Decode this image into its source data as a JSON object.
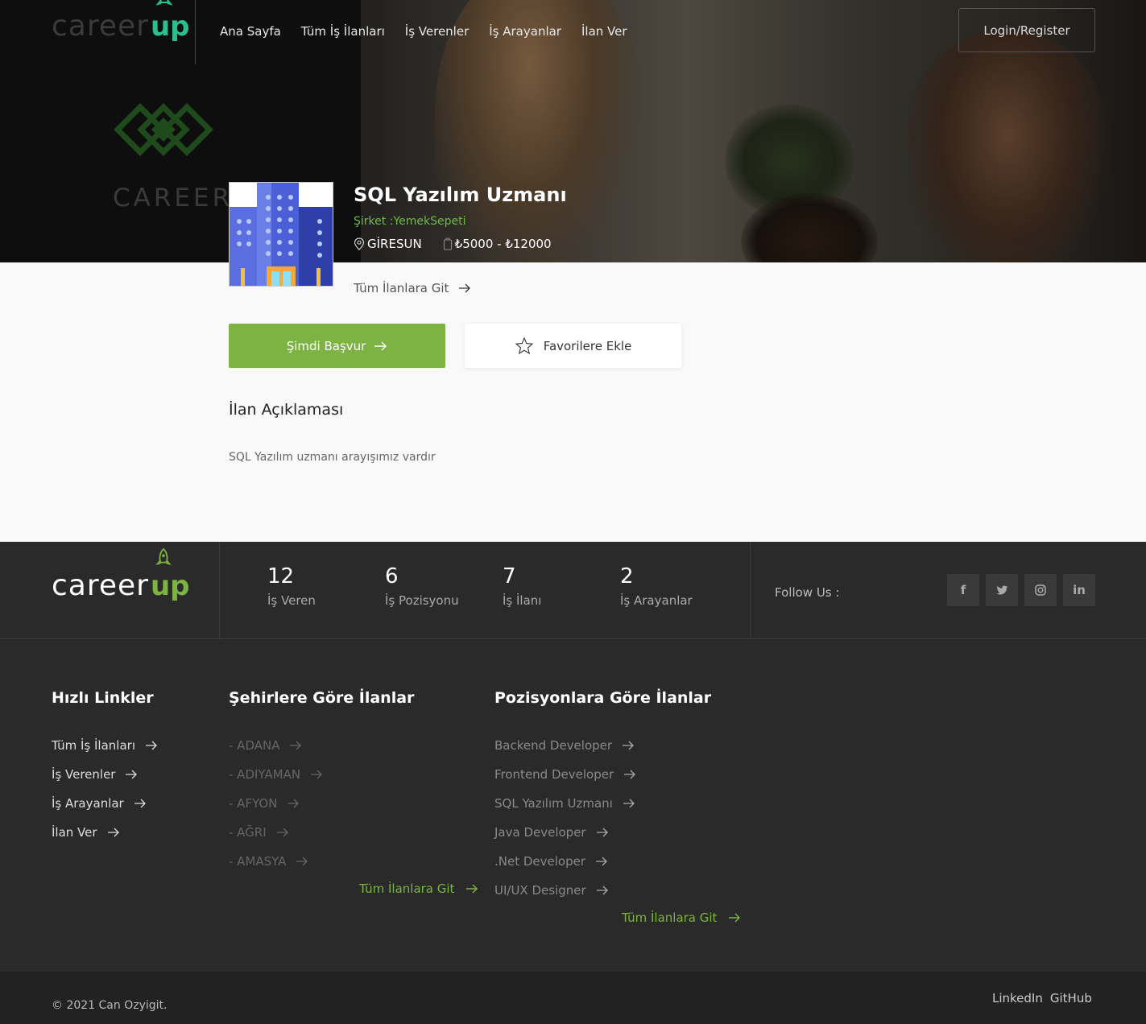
{
  "nav": {
    "brand_text": "career",
    "brand_accent": "up",
    "links": [
      "Ana Sayfa",
      "Tüm İş İlanları",
      "İş Verenler",
      "İş Arayanlar",
      "İlan Ver"
    ],
    "login_label": "Login/Register"
  },
  "hero": {
    "wall_text": "CAREERUP"
  },
  "job": {
    "title": "SQL Yazılım Uzmanı",
    "company_label": "Şirket :YemekSepeti",
    "city": "GİRESUN",
    "salary": "₺5000 - ₺12000",
    "all_jobs_link": "Tüm İlanlara Git",
    "apply_label": "Şimdi Başvur",
    "favorite_label": "Favorilere Ekle",
    "description_title": "İlan Açıklaması",
    "description": "SQL Yazılım uzmanı arayışımız vardır"
  },
  "stats": {
    "brand_text": "career",
    "brand_accent": "up",
    "items": [
      {
        "value": "12",
        "label": "İş Veren"
      },
      {
        "value": "6",
        "label": "İş Pozisyonu"
      },
      {
        "value": "7",
        "label": "İş İlanı"
      },
      {
        "value": "2",
        "label": "İş Arayanlar"
      }
    ],
    "follow_label": "Follow Us :",
    "social": [
      "f",
      "t",
      "◎",
      "in"
    ]
  },
  "footer": {
    "quick_title": "Hızlı Linkler",
    "quick_links": [
      "Tüm İş İlanları",
      "İş Verenler",
      "İş Arayanlar",
      "İlan Ver"
    ],
    "cities_title": "Şehirlere Göre İlanlar",
    "cities": [
      "- ADANA",
      "- ADIYAMAN",
      "- AFYON",
      "- AĞRI",
      "- AMASYA"
    ],
    "cities_all": "Tüm İlanlara Git",
    "positions_title": "Pozisyonlara Göre İlanlar",
    "positions": [
      "Backend Developer",
      "Frontend Developer",
      "SQL Yazılım Uzmanı",
      "Java Developer",
      ".Net Developer",
      "UI/UX Designer"
    ],
    "positions_all": "Tüm İlanlara Git",
    "copyright": "© 2021 Can Ozyigit.",
    "bottom_links": [
      "LinkedIn",
      "GitHub"
    ]
  },
  "colors": {
    "accent_green": "#7db343",
    "brand_teal": "#2cbf8e",
    "footer_bg": "#2a2a2a"
  }
}
